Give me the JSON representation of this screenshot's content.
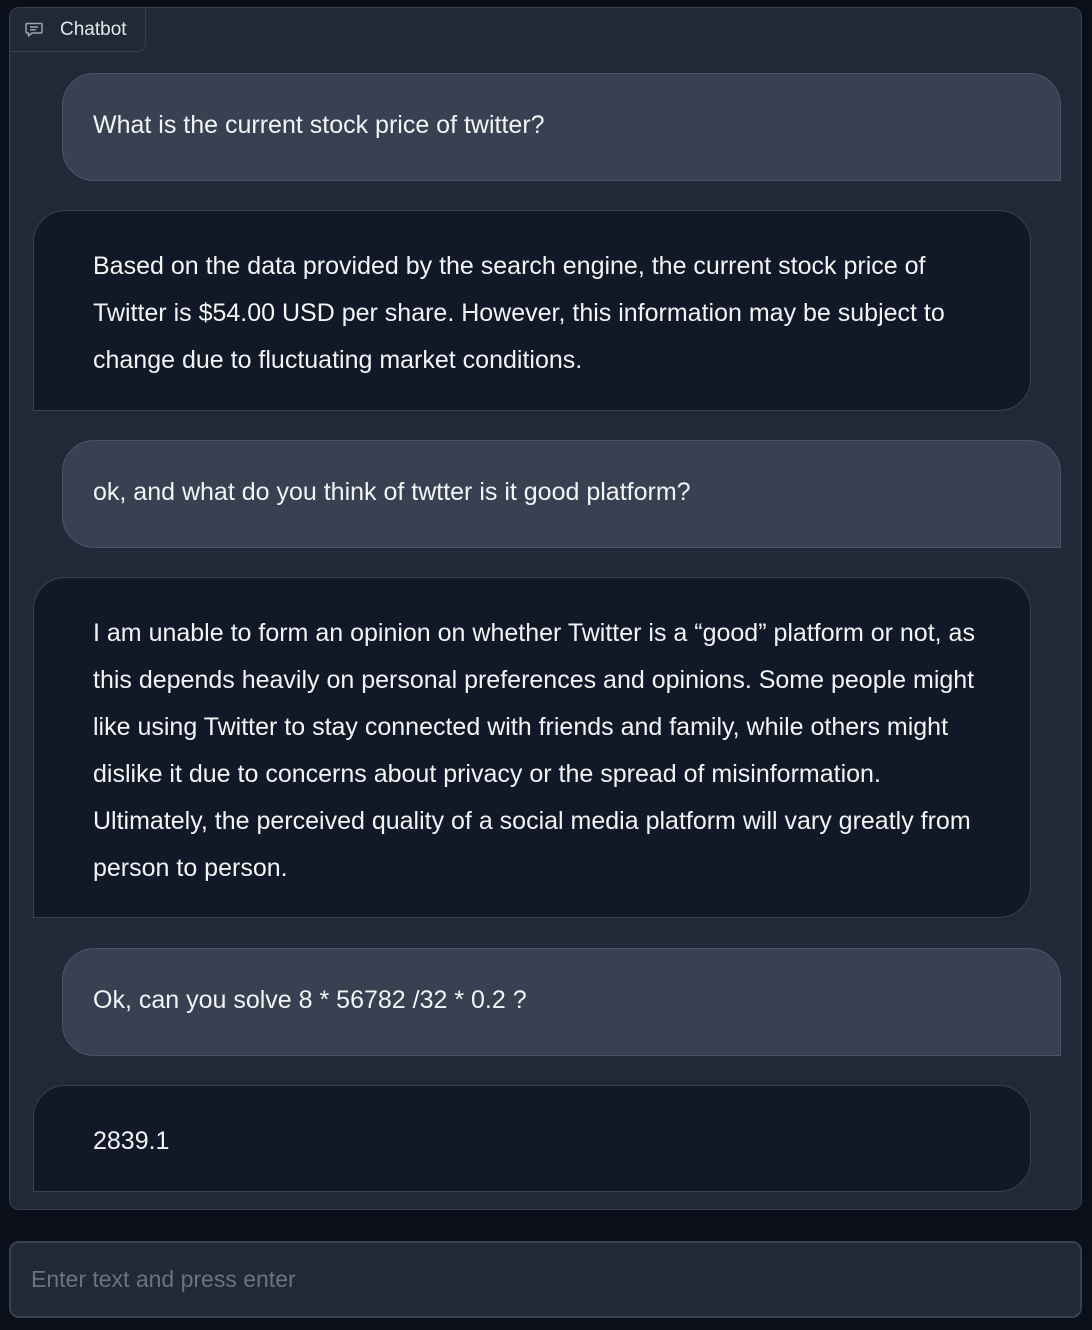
{
  "panel": {
    "label": "Chatbot",
    "icon": "chat-icon"
  },
  "messages": [
    {
      "role": "user",
      "text": "What is the current stock price of twitter?"
    },
    {
      "role": "bot",
      "text": "Based on the data provided by the search engine, the current stock price of Twitter is $54.00 USD per share. However, this information may be subject to change due to fluctuating market conditions."
    },
    {
      "role": "user",
      "text": "ok, and what do you think of twtter is it good platform?"
    },
    {
      "role": "bot",
      "text": "I am unable to form an opinion on whether Twitter is a “good” platform or not, as this depends heavily on personal preferences and opinions. Some people might like using Twitter to stay connected with friends and family, while others might dislike it due to concerns about privacy or the spread of misinformation. Ultimately, the perceived quality of a social media platform will vary greatly from person to person."
    },
    {
      "role": "user",
      "text": "Ok, can you solve 8 * 56782 /32 * 0.2 ?"
    },
    {
      "role": "bot",
      "text": "2839.1"
    }
  ],
  "input": {
    "placeholder": "Enter text and press enter",
    "value": ""
  },
  "colors": {
    "background": "#0b0f19",
    "panel": "#1f2937",
    "user_bubble": "#374151",
    "bot_bubble": "#111827"
  }
}
